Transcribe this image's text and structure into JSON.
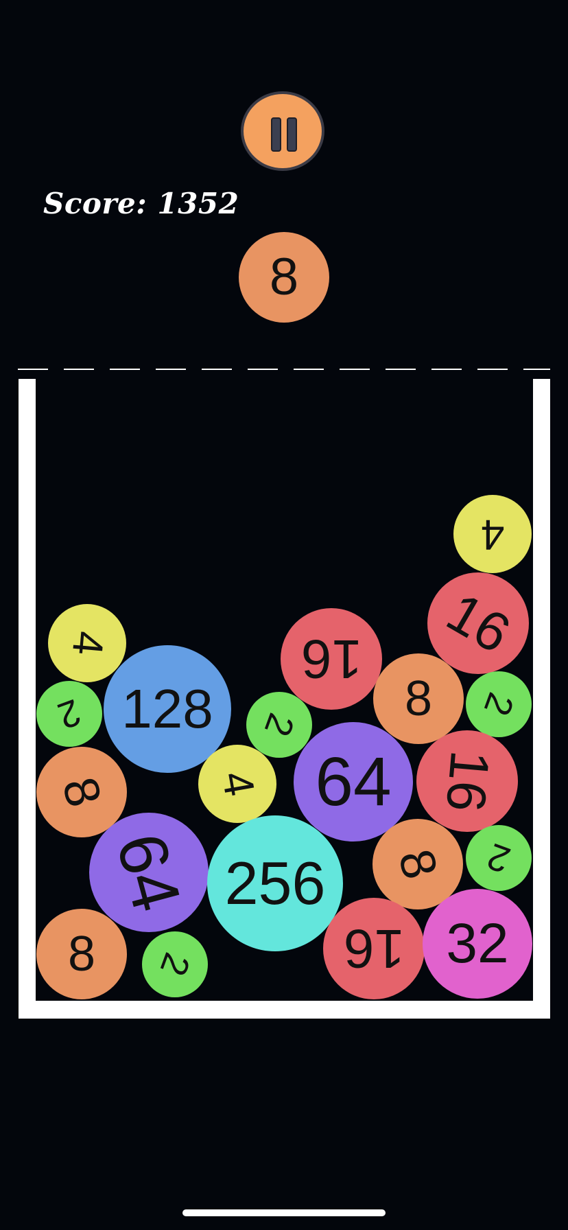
{
  "hud": {
    "score_text": "Score: 1352",
    "pause_icon": "pause-icon"
  },
  "next_ball": {
    "value": "8",
    "color": "#e89462"
  },
  "colors": {
    "2": "#74e05f",
    "4": "#e4e463",
    "8": "#e89462",
    "16": "#e5636b",
    "32": "#e162cd",
    "64": "#8f6ae6",
    "128": "#649ee4",
    "256": "#63e6dc",
    "background": "#03060c",
    "walls": "#ffffff"
  },
  "board": {
    "balls": [
      {
        "value": "4",
        "color": "#e4e463",
        "rotation": 180
      },
      {
        "value": "16",
        "color": "#e5636b",
        "rotation": 30
      },
      {
        "value": "4",
        "color": "#e4e463",
        "rotation": 95
      },
      {
        "value": "16",
        "color": "#e5636b",
        "rotation": 180
      },
      {
        "value": "128",
        "color": "#649ee4",
        "rotation": 0
      },
      {
        "value": "8",
        "color": "#e89462",
        "rotation": 0
      },
      {
        "value": "2",
        "color": "#74e05f",
        "rotation": 160
      },
      {
        "value": "2",
        "color": "#74e05f",
        "rotation": 110
      },
      {
        "value": "2",
        "color": "#74e05f",
        "rotation": 110
      },
      {
        "value": "4",
        "color": "#e4e463",
        "rotation": 80
      },
      {
        "value": "64",
        "color": "#8f6ae6",
        "rotation": 0
      },
      {
        "value": "16",
        "color": "#e5636b",
        "rotation": 95
      },
      {
        "value": "8",
        "color": "#e89462",
        "rotation": 75
      },
      {
        "value": "64",
        "color": "#8f6ae6",
        "rotation": 75
      },
      {
        "value": "256",
        "color": "#63e6dc",
        "rotation": 0
      },
      {
        "value": "8",
        "color": "#e89462",
        "rotation": 75
      },
      {
        "value": "2",
        "color": "#74e05f",
        "rotation": 200
      },
      {
        "value": "8",
        "color": "#e89462",
        "rotation": 0
      },
      {
        "value": "2",
        "color": "#74e05f",
        "rotation": 110
      },
      {
        "value": "16",
        "color": "#e5636b",
        "rotation": 180
      },
      {
        "value": "32",
        "color": "#e162cd",
        "rotation": 0
      }
    ]
  }
}
